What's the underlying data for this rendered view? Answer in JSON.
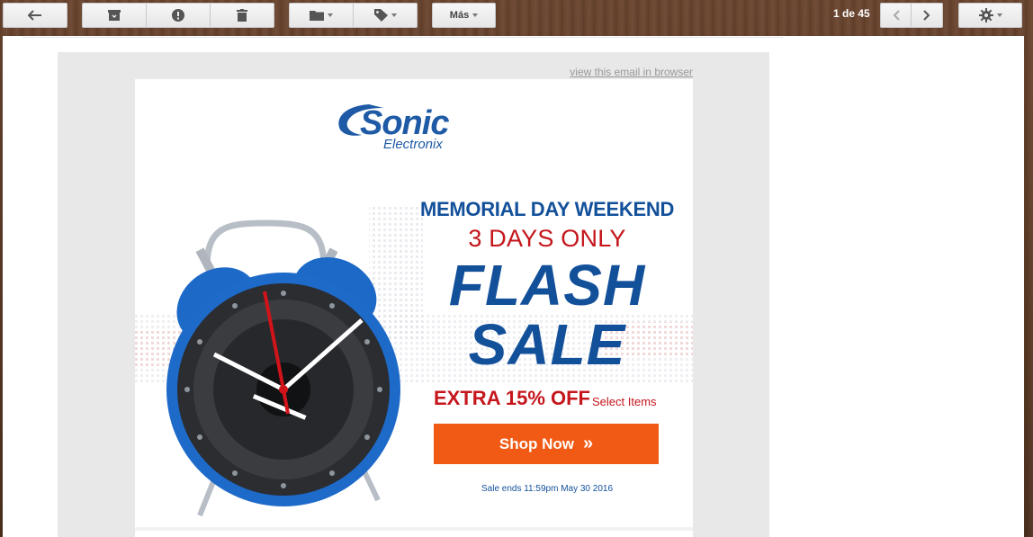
{
  "toolbar": {
    "pager_text": "1 de 45",
    "more_label": "Más",
    "icons": [
      "back-arrow-icon",
      "archive-icon",
      "spam-icon",
      "trash-icon",
      "folder-icon",
      "label-icon",
      "chevron-left-icon",
      "chevron-right-icon",
      "gear-icon"
    ]
  },
  "email": {
    "view_in_browser": "view this email in browser",
    "logo_brand": "Sonic",
    "logo_sub": "Electronix",
    "headline1": "MEMORIAL DAY WEEKEND",
    "headline2": "3 DAYS ONLY",
    "flash": "FLASH",
    "sale": "SALE",
    "extra": "EXTRA 15% OFF",
    "extra_small": "Select Items",
    "shop_button": "Shop Now",
    "shop_button_icon": "»",
    "ends": "Sale ends 11:59pm May 30 2016"
  },
  "colors": {
    "brand_blue": "#13509a",
    "sale_red": "#c4161c",
    "cta_orange": "#f15a14",
    "clock_blue": "#1e6ac8"
  }
}
